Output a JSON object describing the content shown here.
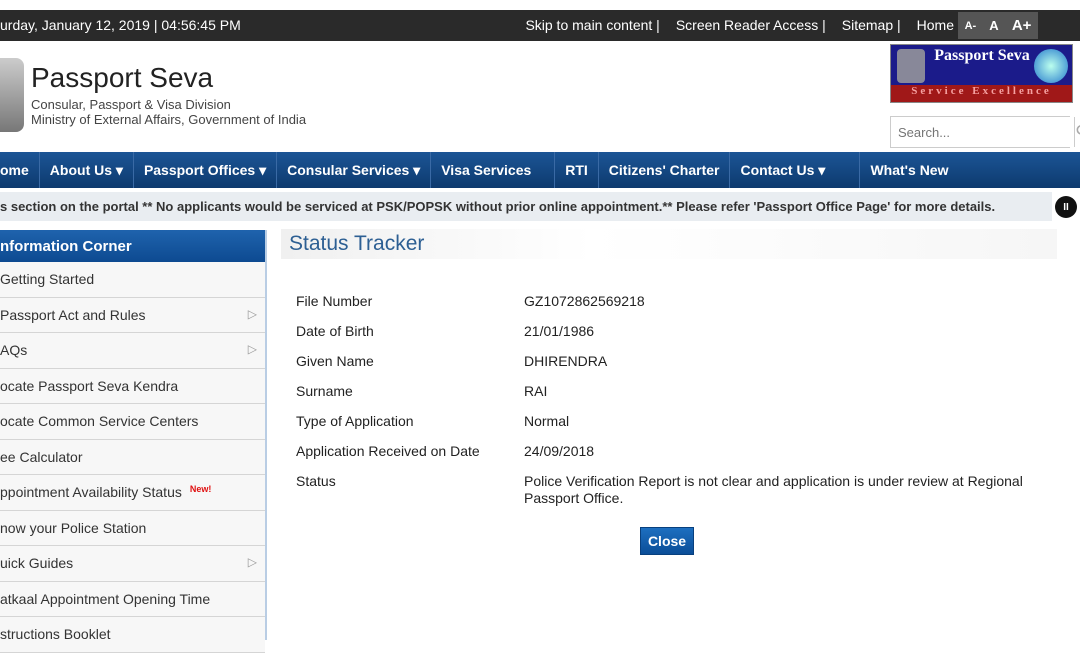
{
  "topbar": {
    "datetime": "urday,  January  12, 2019 | 04:56:45 PM",
    "links": [
      "Skip to main content  |",
      "Screen Reader Access  |",
      "Sitemap  |",
      "Home"
    ],
    "font_sizes": [
      "A-",
      "A",
      "A+"
    ]
  },
  "header": {
    "title": "Passport Seva",
    "subtitle1": "Consular, Passport & Visa Division",
    "subtitle2": "Ministry of External Affairs, Government of India",
    "logo_text": "Passport Seva",
    "logo_tagline": "Service Excellence",
    "search_placeholder": "Search..."
  },
  "nav": [
    "ome",
    "About Us ▾",
    "Passport Offices ▾",
    "Consular Services ▾",
    "Visa Services",
    "RTI",
    "Citizens' Charter",
    "Contact Us ▾",
    "What's New"
  ],
  "ticker": "s section on the portal ** No applicants would be serviced at PSK/POPSK without prior online appointment.** Please refer 'Passport Office Page' for more details.",
  "sidebar": {
    "title": "nformation Corner",
    "items": [
      {
        "label": "Getting Started",
        "arrow": false
      },
      {
        "label": "Passport Act and Rules",
        "arrow": true
      },
      {
        "label": "AQs",
        "arrow": true
      },
      {
        "label": "ocate Passport Seva Kendra",
        "arrow": false
      },
      {
        "label": "ocate Common Service Centers",
        "arrow": false
      },
      {
        "label": "ee Calculator",
        "arrow": false
      },
      {
        "label": "ppointment Availability Status",
        "arrow": false,
        "badge": "New!"
      },
      {
        "label": "now your Police Station",
        "arrow": false
      },
      {
        "label": "uick Guides",
        "arrow": true
      },
      {
        "label": "atkaal Appointment Opening Time",
        "arrow": false
      },
      {
        "label": "structions Booklet",
        "arrow": false
      }
    ]
  },
  "main": {
    "title": "Status Tracker",
    "rows": [
      {
        "k": "File Number",
        "v": "GZ1072862569218"
      },
      {
        "k": "Date of Birth",
        "v": "21/01/1986"
      },
      {
        "k": "Given Name",
        "v": "DHIRENDRA"
      },
      {
        "k": "Surname",
        "v": "RAI"
      },
      {
        "k": "Type of Application",
        "v": "Normal"
      },
      {
        "k": "Application Received on Date",
        "v": "24/09/2018"
      },
      {
        "k": "Status",
        "v": "Police Verification Report is not clear and application is under review at Regional Passport Office."
      }
    ],
    "close_label": "Close"
  },
  "colors": {
    "nav": "#1c5596",
    "accent": "#2d5f93",
    "topbar": "#2a2a2a"
  }
}
